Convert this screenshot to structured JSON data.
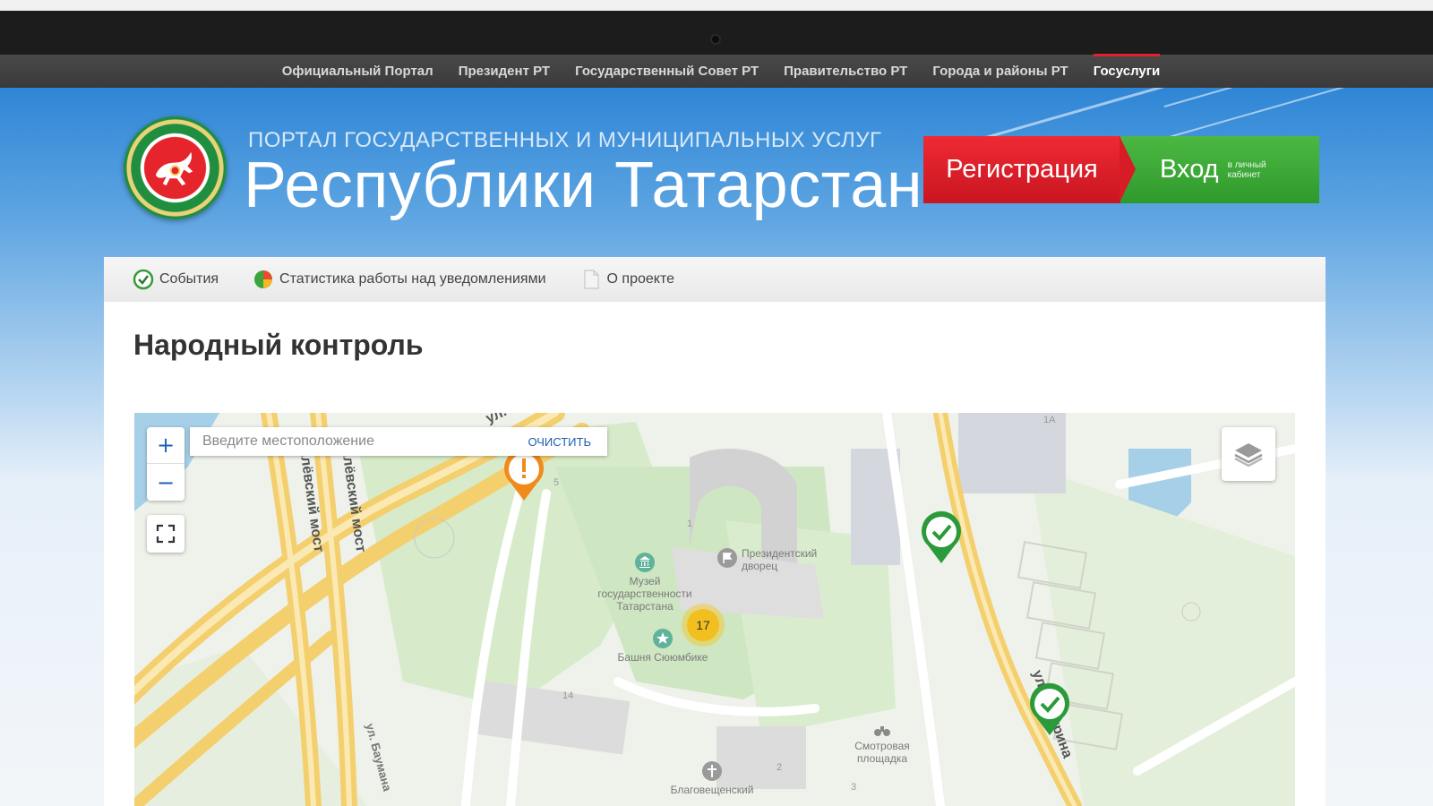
{
  "topnav": {
    "items": [
      {
        "label": "Официальный Портал"
      },
      {
        "label": "Президент РТ"
      },
      {
        "label": "Государственный Совет РТ"
      },
      {
        "label": "Правительство РТ"
      },
      {
        "label": "Города и районы РТ"
      },
      {
        "label": "Госуслуги",
        "active": true
      }
    ]
  },
  "header": {
    "subtitle": "ПОРТАЛ ГОСУДАРСТВЕННЫХ И МУНИЦИПАЛЬНЫХ УСЛУГ",
    "title": "Республики Татарстан",
    "register_label": "Регистрация",
    "login_label": "Вход",
    "login_sub": "в личный кабинет"
  },
  "tabs": [
    {
      "label": "События",
      "icon": "check-circle-icon"
    },
    {
      "label": "Статистика работы над уведомлениями",
      "icon": "pie-chart-icon"
    },
    {
      "label": "О проекте",
      "icon": "document-icon"
    }
  ],
  "page": {
    "title": "Народный контроль"
  },
  "map": {
    "zoom_in": "+",
    "zoom_out": "−",
    "search_placeholder": "Введите местоположение",
    "clear_label": "очистить",
    "cluster_count": "17",
    "labels": {
      "museum": "Музей государственности Татарстана",
      "palace": "Президентский дворец",
      "tower": "Башня Сююмбике",
      "viewpoint": "Смотровая площадка",
      "church": "Благовещенский",
      "street_baturina": "ул. Батурина",
      "street_bauman": "ул. Баумана",
      "bridge_1": "Милёвский мост",
      "bridge_2": "Милёвский мост",
      "street_top": "ул.",
      "num_1": "1",
      "num_14": "14",
      "num_2": "2",
      "num_3": "3",
      "num_1a": "1А",
      "num_5": "5"
    }
  },
  "colors": {
    "register": "#d71c26",
    "login": "#3aa834",
    "marker_done": "#2a9a3a",
    "marker_warning": "#f08a1a",
    "cluster": "#f1bf1e"
  }
}
